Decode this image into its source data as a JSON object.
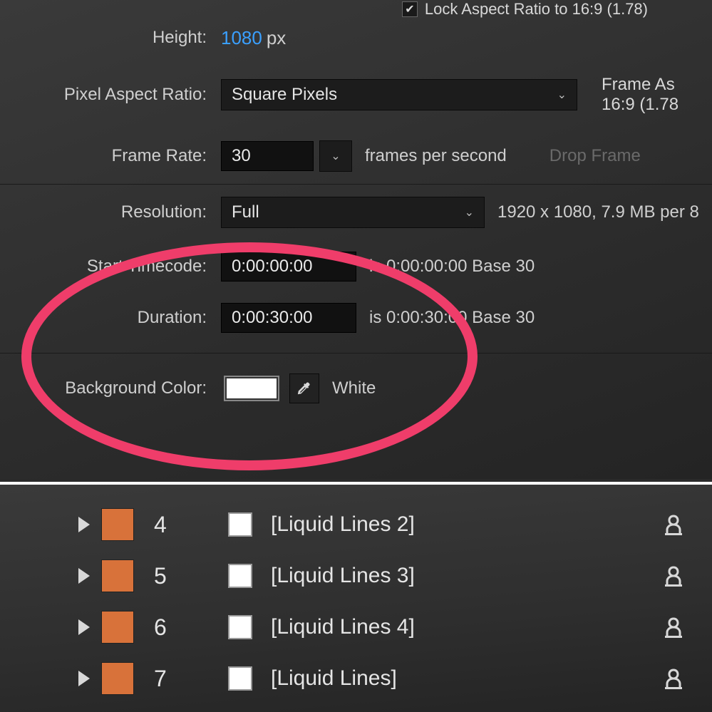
{
  "lock_aspect": {
    "checked": true,
    "label": "Lock Aspect Ratio to 16:9 (1.78)"
  },
  "height": {
    "label": "Height:",
    "value": "1080",
    "unit": "px"
  },
  "pixel_aspect": {
    "label": "Pixel Aspect Ratio:",
    "value": "Square Pixels"
  },
  "frame_aspect": {
    "label": "Frame As",
    "value": "16:9 (1.78"
  },
  "frame_rate": {
    "label": "Frame Rate:",
    "value": "30",
    "unit": "frames per second",
    "drop": "Drop Frame"
  },
  "resolution": {
    "label": "Resolution:",
    "value": "Full",
    "info": "1920 x 1080, 7.9 MB per 8"
  },
  "start_tc": {
    "label": "Start Timecode:",
    "value": "0:00:00:00",
    "info": "is 0:00:00:00  Base 30"
  },
  "duration": {
    "label": "Duration:",
    "value": "0:00:30:00",
    "info": "is 0:00:30:00  Base 30"
  },
  "bg": {
    "label": "Background Color:",
    "name": "White"
  },
  "layers": [
    {
      "num": "4",
      "name": "[Liquid Lines 2]"
    },
    {
      "num": "5",
      "name": "[Liquid Lines 3]"
    },
    {
      "num": "6",
      "name": "[Liquid Lines 4]"
    },
    {
      "num": "7",
      "name": "[Liquid Lines]"
    }
  ]
}
